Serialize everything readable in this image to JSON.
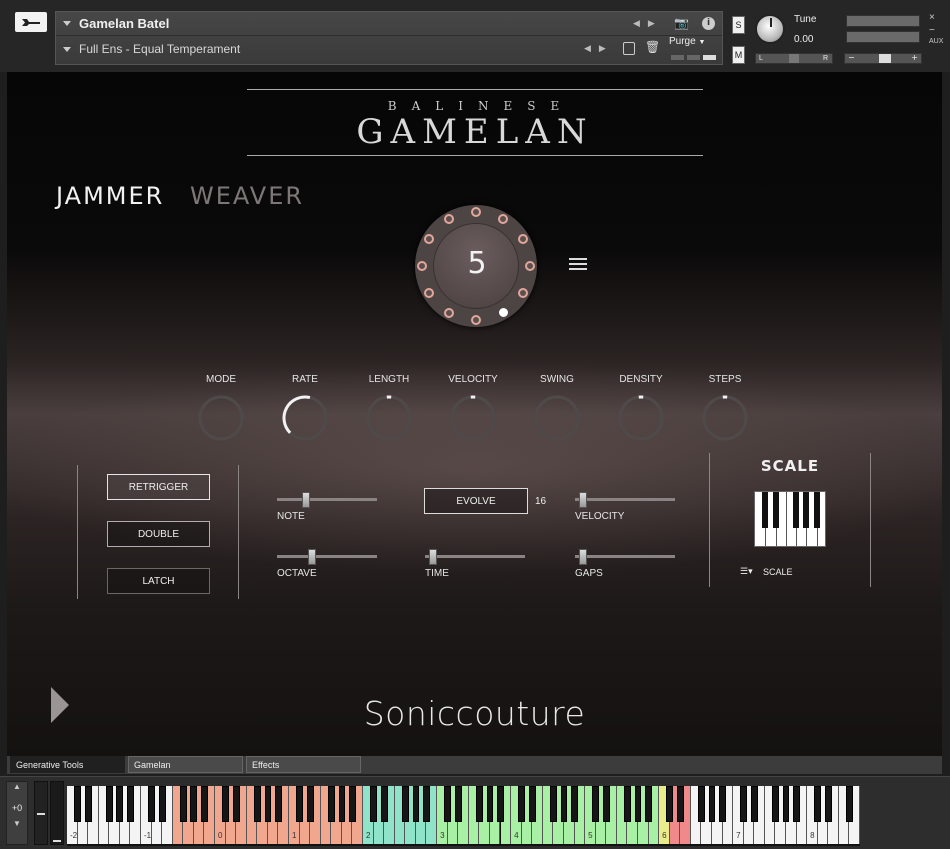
{
  "header": {
    "instrument_name": "Gamelan Batel",
    "preset_name": "Full Ens - Equal Temperament",
    "purge_label": "Purge",
    "solo_label": "S",
    "mute_label": "M",
    "tune_label": "Tune",
    "tune_value": "0.00",
    "pan_left": "L",
    "pan_right": "R",
    "aux_label": "AUX"
  },
  "title": {
    "small": "BALINESE",
    "big": "GAMELAN"
  },
  "mode_tabs": {
    "jammer": "JAMMER",
    "weaver": "WEAVER"
  },
  "steps": {
    "count": "5",
    "total_dots": 12,
    "active_dot": 6
  },
  "knobs": [
    {
      "label": "MODE",
      "value": 0
    },
    {
      "label": "RATE",
      "value": 0.55
    },
    {
      "label": "LENGTH",
      "value": 0.5
    },
    {
      "label": "VELOCITY",
      "value": 0.5
    },
    {
      "label": "SWING",
      "value": 0
    },
    {
      "label": "DENSITY",
      "value": 0.5
    },
    {
      "label": "STEPS",
      "value": 0.5
    }
  ],
  "buttons": {
    "retrigger": "RETRIGGER",
    "double": "DOUBLE",
    "latch": "LATCH"
  },
  "sliders": {
    "note": {
      "label": "NOTE",
      "value": 0.27
    },
    "octave": {
      "label": "OCTAVE",
      "value": 0.34
    },
    "time": {
      "label": "TIME",
      "value": 0.04
    },
    "velocity": {
      "label": "VELOCITY",
      "value": 0.04
    },
    "gaps": {
      "label": "GAPS",
      "value": 0.04
    }
  },
  "evolve": {
    "label": "EVOLVE",
    "value": "16"
  },
  "scale": {
    "title": "SCALE",
    "menu_label": "SCALE",
    "menu_icon": "list-icon"
  },
  "brand": "Soniccouture",
  "tabs": [
    "Generative Tools",
    "Gamelan",
    "Effects"
  ],
  "keyboard": {
    "octave_shift": "+0",
    "octave_labels": [
      "-2",
      "-1",
      "0",
      "1",
      "2",
      "3",
      "4",
      "5",
      "6",
      "7",
      "8"
    ],
    "colors": {
      "orange": "#f1a78e",
      "teal": "#8fe3c9",
      "green": "#a8f0a3",
      "yellow": "#e8ec8a",
      "red": "#f08a8a"
    }
  },
  "colors": {
    "accent_dot": "#e2a79b",
    "panel_text": "#e6e6e6"
  }
}
